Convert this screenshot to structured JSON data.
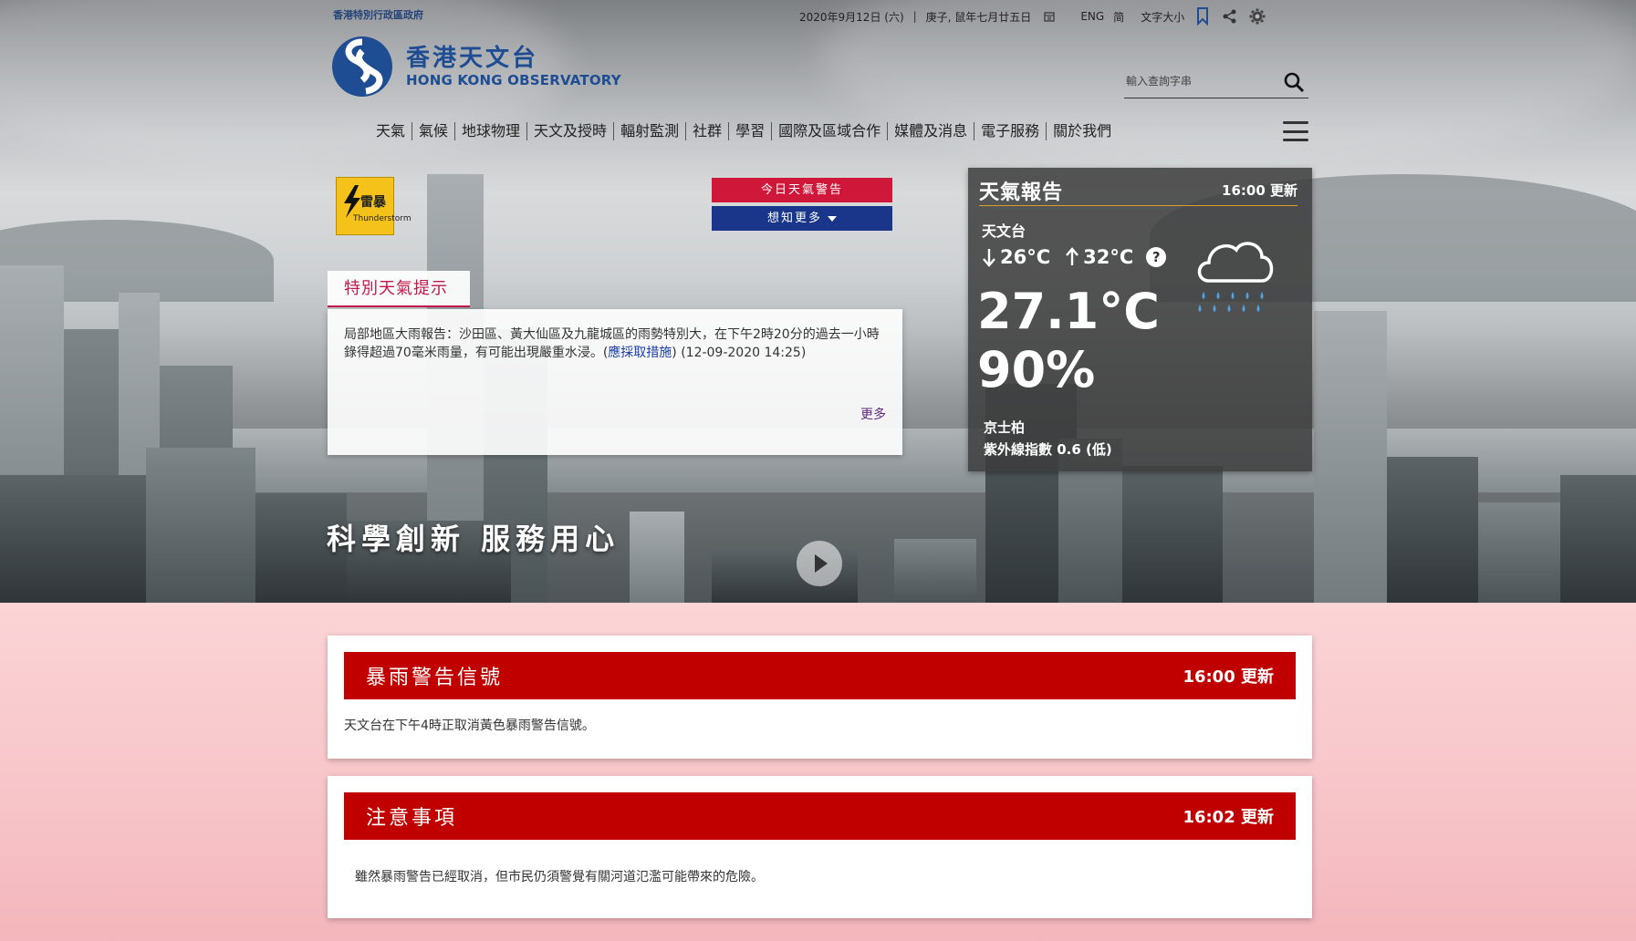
{
  "header": {
    "gov_label": "香港特別行政區政府",
    "date": "2020年9月12日 (六)",
    "lunar": "庚子, 鼠年七月廿五日",
    "lang_en": "ENG",
    "lang_simplified": "简",
    "font_size": "文字大小",
    "icons": [
      "calendar-icon",
      "bookmark-icon",
      "share-icon",
      "gear-icon"
    ]
  },
  "logo": {
    "cn": "香港天文台",
    "en": "HONG KONG OBSERVATORY"
  },
  "search": {
    "placeholder": "輸入查詢字串"
  },
  "nav": {
    "items": [
      "天氣",
      "氣候",
      "地球物理",
      "天文及授時",
      "輻射監測",
      "社群",
      "學習",
      "國際及區域合作",
      "媒體及消息",
      "電子服務",
      "關於我們"
    ]
  },
  "warning_icon": {
    "cn": "雷暴",
    "en": "Thunderstorm"
  },
  "buttons": {
    "today_warning": "今日天氣警告",
    "learn_more": "想知更多"
  },
  "tips": {
    "tab": "特別天氣提示",
    "text_before": "局部地區大雨報告：沙田區、黃大仙區及九龍城區的雨勢特別大，在下午2時20分的過去一小時錄得超過70毫米雨量，有可能出現嚴重水浸。(",
    "link": "應採取措施",
    "text_after": ") (12-09-2020 14:25)",
    "more": "更多"
  },
  "weather": {
    "title": "天氣報告",
    "updated": "16:00 更新",
    "station": "天文台",
    "low": "26°C",
    "high": "32°C",
    "help": "?",
    "temperature": "27.1°C",
    "humidity": "90%",
    "place": "京士柏",
    "uv": "紫外線指數 0.6 (低)"
  },
  "slogan": "科學創新 服務用心",
  "cards": [
    {
      "title": "暴雨警告信號",
      "updated": "16:00 更新",
      "body": "天文台在下午4時正取消黃色暴雨警告信號。"
    },
    {
      "title": "注意事項",
      "updated": "16:02 更新",
      "body": "雖然暴雨警告已經取消，但市民仍須警覺有關河道氾濫可能帶來的危險。"
    }
  ],
  "colors": {
    "brand_blue": "#1e4d93",
    "warning_red": "#c00000",
    "button_red": "#cf1739",
    "button_blue": "#19368a",
    "tips_accent": "#c2184b",
    "lower_bg": "#f7c4c8"
  }
}
